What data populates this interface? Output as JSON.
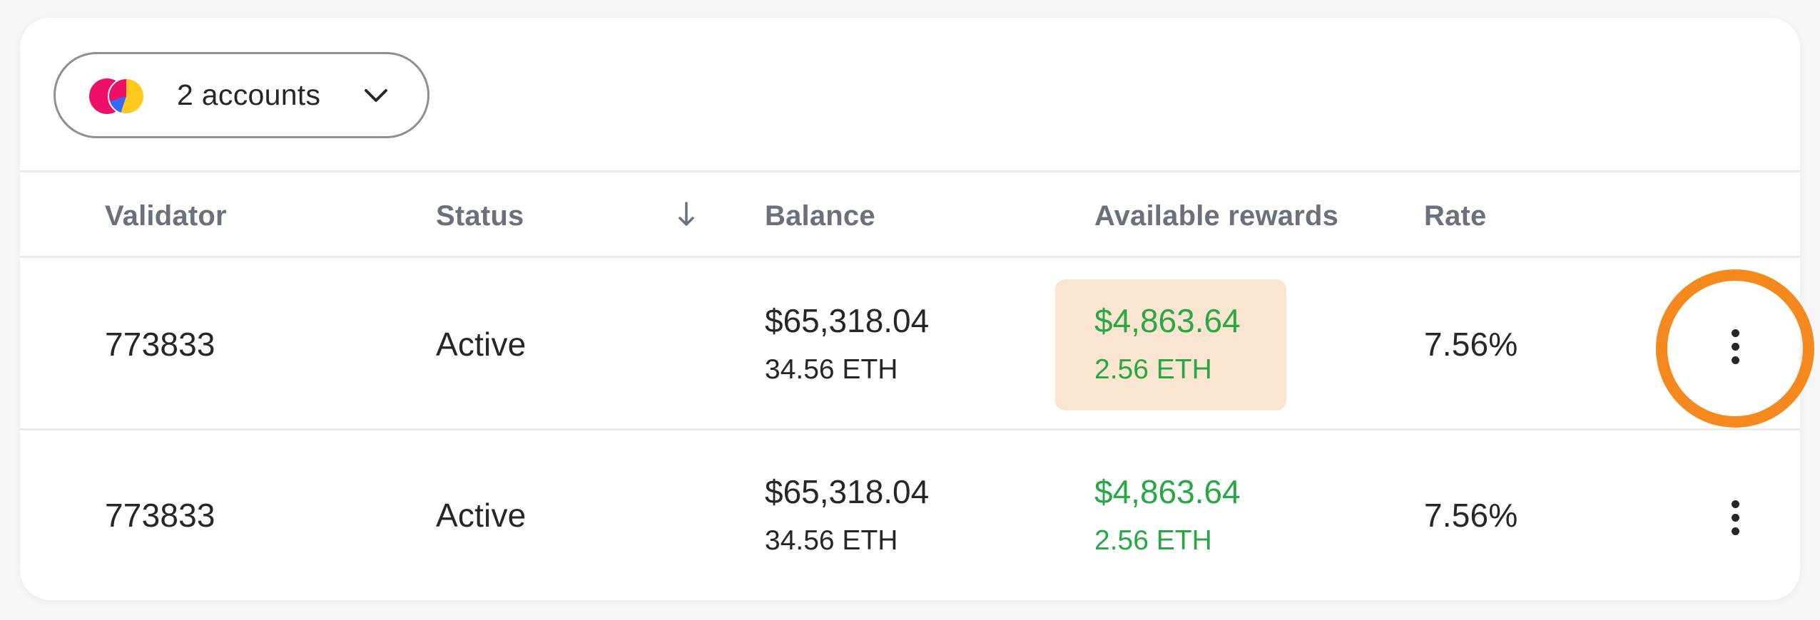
{
  "account_picker": {
    "label": "2 accounts",
    "avatar_colors": [
      "#f00f68",
      "#ffc81e",
      "#2f6bff"
    ]
  },
  "table": {
    "columns": {
      "validator": "Validator",
      "status": "Status",
      "balance": "Balance",
      "rewards": "Available rewards",
      "rate": "Rate"
    },
    "sort_icon": "arrow-down-icon",
    "rows": [
      {
        "validator": "773833",
        "status": "Active",
        "balance_usd": "$65,318.04",
        "balance_eth": "34.56 ETH",
        "rewards_usd": "$4,863.64",
        "rewards_eth": "2.56 ETH",
        "rate": "7.56%",
        "menu_icon": "more-vertical-icon",
        "highlighted": true
      },
      {
        "validator": "773833",
        "status": "Active",
        "balance_usd": "$65,318.04",
        "balance_eth": "34.56 ETH",
        "rewards_usd": "$4,863.64",
        "rewards_eth": "2.56 ETH",
        "rate": "7.56%",
        "menu_icon": "more-vertical-icon",
        "highlighted": false
      }
    ]
  },
  "colors": {
    "reward_text": "#28a745",
    "reward_highlight": "#fae5d0",
    "focus_ring": "#f5891d"
  }
}
